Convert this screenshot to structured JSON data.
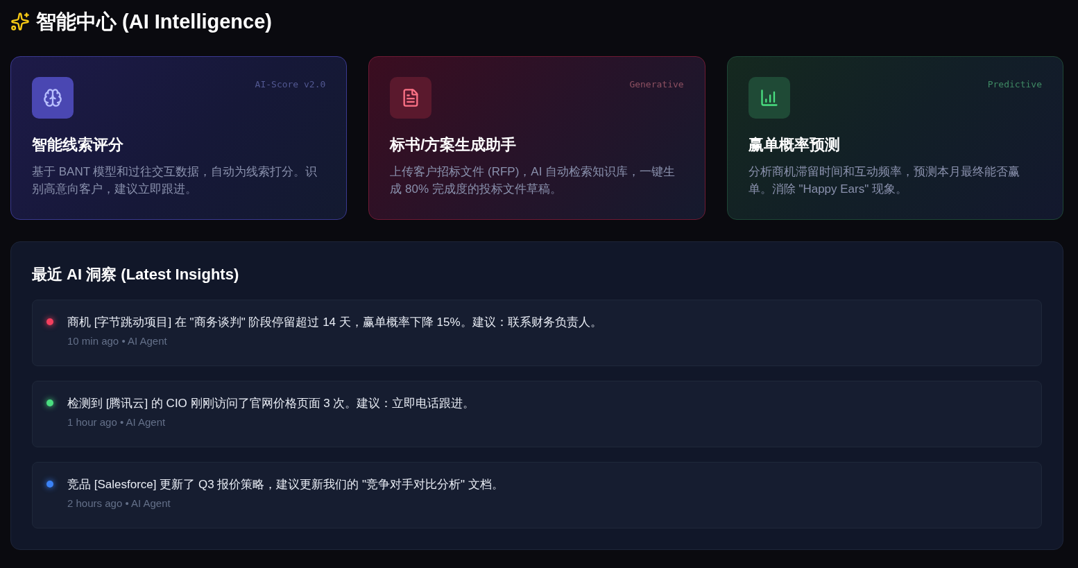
{
  "header": {
    "title": "智能中心 (AI Intelligence)"
  },
  "feature_cards": [
    {
      "kind": "scoring",
      "tag": "AI-Score v2.0",
      "title": "智能线索评分",
      "description": "基于 BANT 模型和过往交互数据，自动为线索打分。识别高意向客户，建议立即跟进。"
    },
    {
      "kind": "generative",
      "tag": "Generative",
      "title": "标书/方案生成助手",
      "description": "上传客户招标文件 (RFP)，AI 自动检索知识库，一键生成 80% 完成度的投标文件草稿。"
    },
    {
      "kind": "predictive",
      "tag": "Predictive",
      "title": "赢单概率预测",
      "description": "分析商机滞留时间和互动频率，预测本月最终能否赢单。消除 \"Happy Ears\" 现象。"
    }
  ],
  "insights": {
    "title": "最近 AI 洞察 (Latest Insights)",
    "items": [
      {
        "color": "#f43f5e",
        "text": "商机 [字节跳动项目] 在 \"商务谈判\" 阶段停留超过 14 天，赢单概率下降 15%。建议：联系财务负责人。",
        "meta": "10 min ago • AI Agent"
      },
      {
        "color": "#4ade80",
        "text": "检测到 [腾讯云] 的 CIO 刚刚访问了官网价格页面 3 次。建议：立即电话跟进。",
        "meta": "1 hour ago • AI Agent"
      },
      {
        "color": "#3b82f6",
        "text": "竞品 [Salesforce] 更新了 Q3 报价策略，建议更新我们的 \"竞争对手对比分析\" 文档。",
        "meta": "2 hours ago • AI Agent"
      }
    ]
  }
}
